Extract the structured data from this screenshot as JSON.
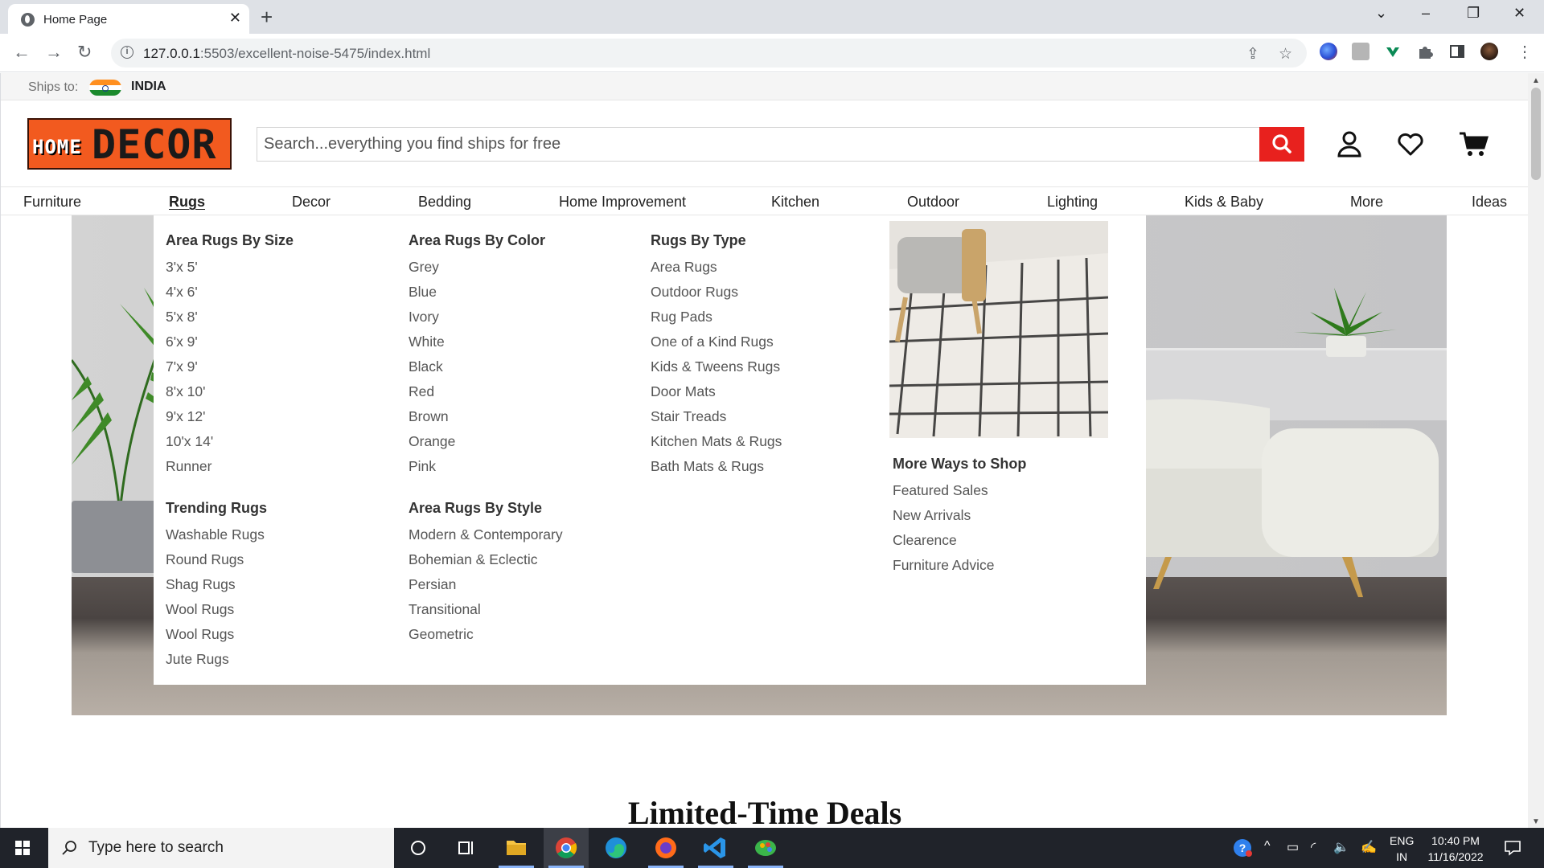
{
  "browser": {
    "tab_title": "Home Page",
    "url_host": "127.0.0.1",
    "url_rest": ":5503/excellent-noise-5475/index.html"
  },
  "shipbar": {
    "label": "Ships to:",
    "country": "INDIA"
  },
  "logo": {
    "part1": "HOME",
    "part2": "DECOR"
  },
  "search": {
    "placeholder": "Search...everything you find ships for free"
  },
  "nav": [
    {
      "label": "Furniture"
    },
    {
      "label": "Rugs"
    },
    {
      "label": "Decor"
    },
    {
      "label": "Bedding"
    },
    {
      "label": "Home Improvement"
    },
    {
      "label": "Kitchen"
    },
    {
      "label": "Outdoor"
    },
    {
      "label": "Lighting"
    },
    {
      "label": "Kids & Baby"
    },
    {
      "label": "More"
    },
    {
      "label": "Ideas"
    }
  ],
  "mega": {
    "size": {
      "heading": "Area Rugs By Size",
      "items": [
        "3'x 5'",
        "4'x 6'",
        "5'x 8'",
        "6'x 9'",
        "7'x 9'",
        "8'x 10'",
        "9'x 12'",
        "10'x 14'",
        "Runner"
      ]
    },
    "trending": {
      "heading": "Trending Rugs",
      "items": [
        "Washable Rugs",
        "Round Rugs",
        "Shag Rugs",
        "Wool Rugs",
        "Wool Rugs",
        "Jute Rugs"
      ]
    },
    "color": {
      "heading": "Area Rugs By Color",
      "items": [
        "Grey",
        "Blue",
        "Ivory",
        "White",
        "Black",
        "Red",
        "Brown",
        "Orange",
        "Pink"
      ]
    },
    "style": {
      "heading": "Area Rugs By Style",
      "items": [
        "Modern & Contemporary",
        "Bohemian & Eclectic",
        "Persian",
        "Transitional",
        "Geometric"
      ]
    },
    "type": {
      "heading": "Rugs By Type",
      "items": [
        "Area Rugs",
        "Outdoor Rugs",
        "Rug Pads",
        "One of a Kind Rugs",
        "Kids & Tweens Rugs",
        "Door Mats",
        "Stair Treads",
        "Kitchen Mats & Rugs",
        "Bath Mats & Rugs"
      ]
    },
    "more": {
      "heading": "More Ways to Shop",
      "items": [
        "Featured Sales",
        "New Arrivals",
        "Clearence",
        "Furniture Advice"
      ]
    }
  },
  "section_title": "Limited-Time Deals",
  "taskbar": {
    "search_text": "Type here to search",
    "lang": "ENG",
    "region": "IN",
    "time": "10:40 PM",
    "date": "11/16/2022"
  },
  "colors": {
    "brand_orange": "#f25a1f",
    "search_red": "#e8211e"
  }
}
